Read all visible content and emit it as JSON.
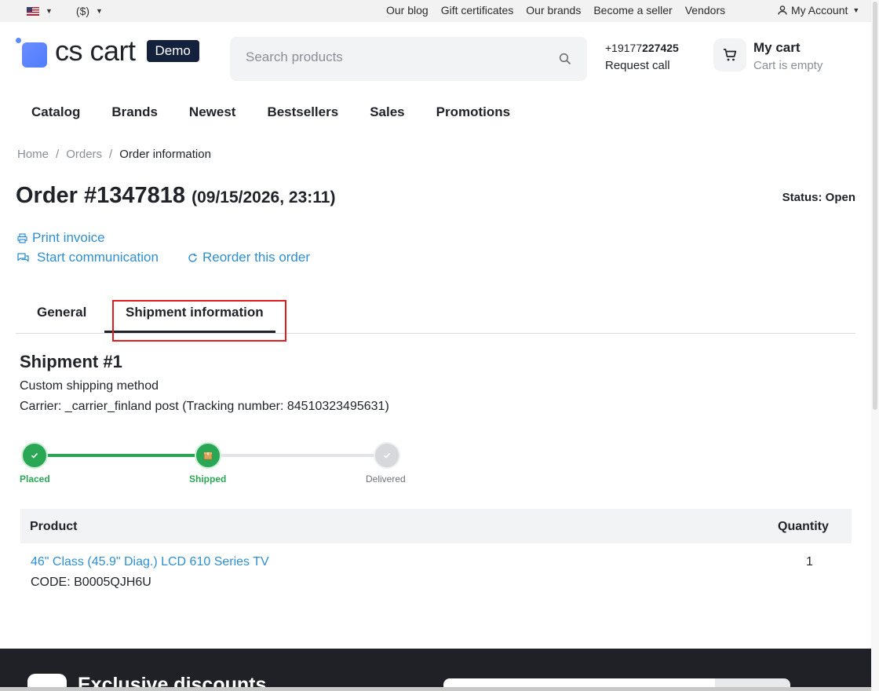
{
  "topbar": {
    "currency": "($)",
    "links": [
      "Our blog",
      "Gift certificates",
      "Our brands",
      "Become a seller",
      "Vendors"
    ],
    "account": "My Account"
  },
  "header": {
    "logo_text": "cs cart",
    "demo_badge": "Demo",
    "search_placeholder": "Search products",
    "phone_prefix": "+19177",
    "phone_bold": "227425",
    "request_call": "Request call",
    "cart_title": "My cart",
    "cart_status": "Cart is empty"
  },
  "nav": [
    "Catalog",
    "Brands",
    "Newest",
    "Bestsellers",
    "Sales",
    "Promotions"
  ],
  "breadcrumb": {
    "items": [
      "Home",
      "Orders"
    ],
    "separator": "/",
    "current": "Order information"
  },
  "order": {
    "title": "Order #1347818",
    "date": "(09/15/2026, 23:11)",
    "status": "Status: Open"
  },
  "actions": {
    "print": "Print invoice",
    "communicate": "Start communication",
    "reorder": "Reorder this order"
  },
  "tabs": {
    "general": "General",
    "shipment": "Shipment information",
    "active": "shipment"
  },
  "shipment": {
    "title": "Shipment #1",
    "method": "Custom shipping method",
    "carrier": "Carrier: _carrier_finland post (Tracking number: 84510323495631)",
    "steps": [
      {
        "label": "Placed",
        "state": "done"
      },
      {
        "label": "Shipped",
        "state": "done"
      },
      {
        "label": "Delivered",
        "state": "todo"
      }
    ]
  },
  "table": {
    "headers": {
      "product": "Product",
      "quantity": "Quantity"
    },
    "rows": [
      {
        "name": "46\" Class (45.9\" Diag.) LCD 610 Series TV",
        "code": "CODE: B0005QJH6U",
        "qty": "1"
      }
    ]
  },
  "footer": {
    "title": "Exclusive discounts"
  },
  "colors": {
    "link": "#2e8fd0",
    "success": "#2aa755",
    "highlight": "#e11d1d",
    "badge": "#14213d"
  }
}
